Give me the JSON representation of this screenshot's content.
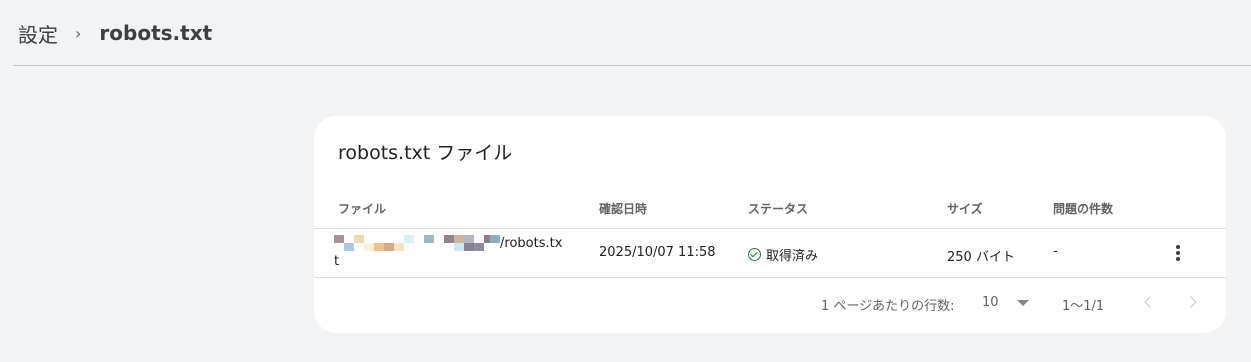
{
  "breadcrumb": {
    "root": "設定",
    "separator": "›",
    "current": "robots.txt"
  },
  "card": {
    "title": "robots.txt ファイル",
    "columns": {
      "file": "ファイル",
      "checked": "確認日時",
      "status": "ステータス",
      "size": "サイズ",
      "issues": "問題の件数"
    },
    "rows": [
      {
        "file_suffix": "/robots.tx",
        "file_tail": "t",
        "checked": "2025/10/07 11:58",
        "status": "取得済み",
        "status_color": "#188038",
        "size": "250 バイト",
        "issues": "-"
      }
    ],
    "footer": {
      "rows_per_page_label": "1 ページあたりの行数:",
      "rows_per_page": "10",
      "range": "1〜1/1"
    }
  },
  "icons": {
    "breadcrumb_separator": "chevron-right-icon",
    "status": "check-circle-icon",
    "row_menu": "more-vert-icon",
    "dropdown": "arrow-drop-down-icon",
    "previous": "chevron-left-icon",
    "next": "chevron-right-icon"
  }
}
